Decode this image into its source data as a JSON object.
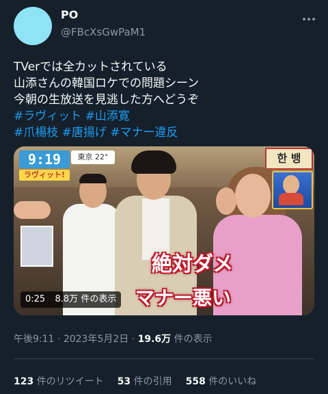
{
  "user": {
    "display_name": "PO",
    "handle": "@FBcXsGwPaM1"
  },
  "tweet": {
    "lines": [
      "TVerでは全カットされている",
      "山添さんの韓国ロケでの問題シーン",
      "今朝の生放送を見逃した方へどうぞ"
    ],
    "hashtags_line1": [
      "#ラヴィット",
      "#山添寛"
    ],
    "hashtags_line2": [
      "#爪楊枝",
      "#唐揚げ",
      "#マナー違反"
    ]
  },
  "video": {
    "clock": "9:19",
    "show_logo": "ラヴィット!",
    "weather": "東京 22°",
    "korean_sign": "한 뱅",
    "caption_top": "絶対ダメ",
    "caption_bottom": "マナー悪い",
    "duration": "0:25",
    "views_count": "8.8万",
    "views_label": "件の表示"
  },
  "meta": {
    "time": "午後9:11",
    "separator": "·",
    "date": "2023年5月2日",
    "separator2": "·",
    "views_count": "19.6万",
    "views_label": "件の表示"
  },
  "stats": {
    "retweets_count": "123",
    "retweets_label": "件のリツイート",
    "quotes_count": "53",
    "quotes_label": "件の引用",
    "likes_count": "558",
    "likes_label": "件のいいね"
  },
  "colors": {
    "background": "#15202b",
    "hashtag": "#1d9bf0",
    "secondary_text": "#8b98a5",
    "avatar": "#8ee3f5"
  },
  "icons": {
    "more": "more-horizontal-icon"
  }
}
